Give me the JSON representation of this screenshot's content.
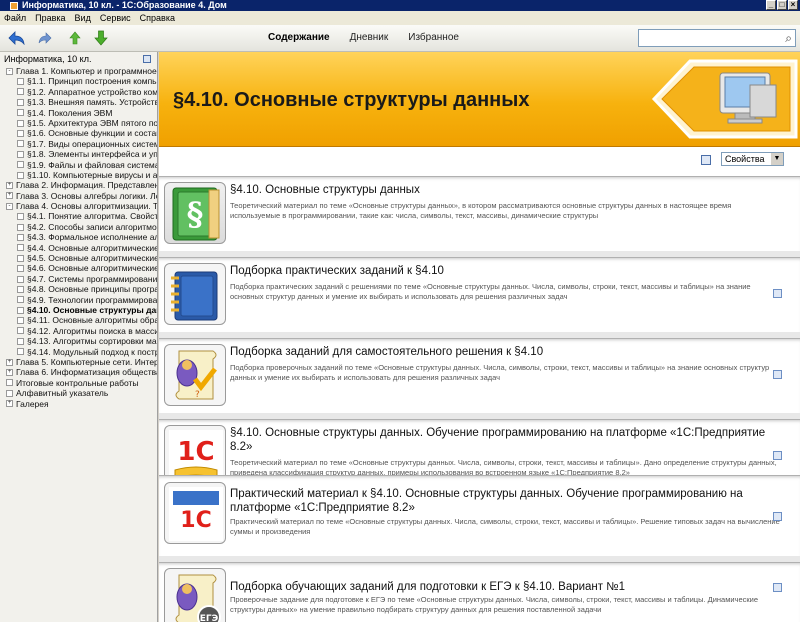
{
  "window": {
    "title": "Информатика, 10 кл. - 1С:Образование 4. Дом"
  },
  "menu": [
    "Файл",
    "Правка",
    "Вид",
    "Сервис",
    "Справка"
  ],
  "toolbar": {
    "tabs": [
      {
        "label": "Содержание",
        "active": true
      },
      {
        "label": "Дневник",
        "active": false
      },
      {
        "label": "Избранное",
        "active": false
      }
    ],
    "search_value": ""
  },
  "sidebar": {
    "header": "Информатика, 10 кл.",
    "items": [
      {
        "label": "Глава 1. Компьютер и программное о",
        "level": 0,
        "toggle": "-"
      },
      {
        "label": "§1.1. Принцип построения компь",
        "level": 1
      },
      {
        "label": "§1.2. Аппаратное устройство комп",
        "level": 1
      },
      {
        "label": "§1.3. Внешняя память. Устройства",
        "level": 1
      },
      {
        "label": "§1.4. Поколения ЭВМ",
        "level": 1
      },
      {
        "label": "§1.5. Архитектура ЭВМ пятого пок",
        "level": 1
      },
      {
        "label": "§1.6. Основные функции и состав",
        "level": 1
      },
      {
        "label": "§1.7. Виды операционных систем",
        "level": 1
      },
      {
        "label": "§1.8. Элементы интерфейса и упр",
        "level": 1
      },
      {
        "label": "§1.9. Файлы и файловая система",
        "level": 1
      },
      {
        "label": "§1.10. Компьютерные вирусы и а",
        "level": 1
      },
      {
        "label": "Глава 2. Информация. Представлен",
        "level": 0,
        "toggle": "+"
      },
      {
        "label": "Глава 3. Основы алгебры логики. Ло",
        "level": 0,
        "toggle": "+"
      },
      {
        "label": "Глава 4. Основы алгоритмизации. Те",
        "level": 0,
        "toggle": "-"
      },
      {
        "label": "§4.1. Понятие алгоритма. Свойст",
        "level": 1
      },
      {
        "label": "§4.2. Способы записи алгоритмов",
        "level": 1
      },
      {
        "label": "§4.3. Формальное исполнение ал",
        "level": 1
      },
      {
        "label": "§4.4. Основные алгоритмические",
        "level": 1
      },
      {
        "label": "§4.5. Основные алгоритмические",
        "level": 1
      },
      {
        "label": "§4.6. Основные алгоритмические",
        "level": 1
      },
      {
        "label": "§4.7. Системы программирования",
        "level": 1
      },
      {
        "label": "§4.8. Основные принципы програм",
        "level": 1
      },
      {
        "label": "§4.9. Технологии программирова",
        "level": 1
      },
      {
        "label": "§4.10. Основные структуры данн",
        "level": 1,
        "active": true
      },
      {
        "label": "§4.11. Основные алгоритмы обра",
        "level": 1
      },
      {
        "label": "§4.12. Алгоритмы поиска в масси",
        "level": 1
      },
      {
        "label": "§4.13. Алгоритмы сортировки мас",
        "level": 1
      },
      {
        "label": "§4.14. Модульный подход к постр",
        "level": 1
      },
      {
        "label": "Глава 5. Компьютерные сети. Интер",
        "level": 0,
        "toggle": "+"
      },
      {
        "label": "Глава 6. Информатизация общества",
        "level": 0,
        "toggle": "+"
      },
      {
        "label": "Итоговые контрольные работы",
        "level": 0,
        "toggle": ""
      },
      {
        "label": "Алфавитный указатель",
        "level": 0,
        "toggle": ""
      },
      {
        "label": "Галерея",
        "level": 0,
        "toggle": "+"
      }
    ]
  },
  "banner": {
    "title": "§4.10. Основные структуры данных"
  },
  "props": {
    "select_value": "Свойства"
  },
  "cards": [
    {
      "title": "§4.10. Основные структуры данных",
      "desc": "Теоретический материал по теме «Основные структуры данных», в котором рассматриваются основные структуры данных в настоящее время используемые в программировании, такие как: числа, символы, текст, массивы, динамические структуры",
      "icon": "paragraph-book-icon",
      "checkbox": false
    },
    {
      "title": "Подборка практических заданий к §4.10",
      "desc": "Подборка практических заданий с решениями по теме «Основные структуры данных. Числа, символы, строки, текст, массивы и таблицы» на знание основных структур данных и умение их выбирать и использовать для решения различных задач",
      "icon": "notebook-icon",
      "checkbox": true
    },
    {
      "title": "Подборка заданий для самостоятельного решения к §4.10",
      "desc": "Подборка проверочных заданий по теме «Основные структуры данных. Числа, символы, строки, текст, массивы и таблицы» на знание основных структур данных и умение их выбирать и использовать для решения различных задач",
      "icon": "test-scroll-icon",
      "checkbox": true
    },
    {
      "title": "§4.10. Основные структуры данных. Обучение программированию на платформе «1С:Предприятие 8.2»",
      "desc": "Теоретический материал по теме «Основные структуры данных. Числа, символы, строки, текст, массивы и таблицы». Дано определение структуры данных, приведена классификация структур данных, примеры использования во встроенном языке «1С:Предприятие 8.2»",
      "icon": "1c-book-icon",
      "checkbox": true
    },
    {
      "title": "Практический материал к §4.10. Основные структуры данных. Обучение программированию на платформе «1С:Предприятие 8.2»",
      "desc": "Практический материал по теме «Основные структуры данных. Числа, символы, строки, текст, массивы и таблицы». Решение типовых задач на вычисление суммы и произведения",
      "icon": "1c-practice-icon",
      "checkbox": true
    },
    {
      "title": "Подборка обучающих заданий для подготовки к ЕГЭ к §4.10. Вариант №1",
      "desc": "Проверочные задание для подготовке к ЕГЭ по теме «Основные структуры данных. Числа, символы, строки, текст, массивы и таблицы. Динамические структуры данных» на умение правильно подбирать структуру данных для решения поставленной задачи",
      "icon": "ege-test-icon",
      "icon_text": "ЕГЭ",
      "checkbox": true
    }
  ]
}
